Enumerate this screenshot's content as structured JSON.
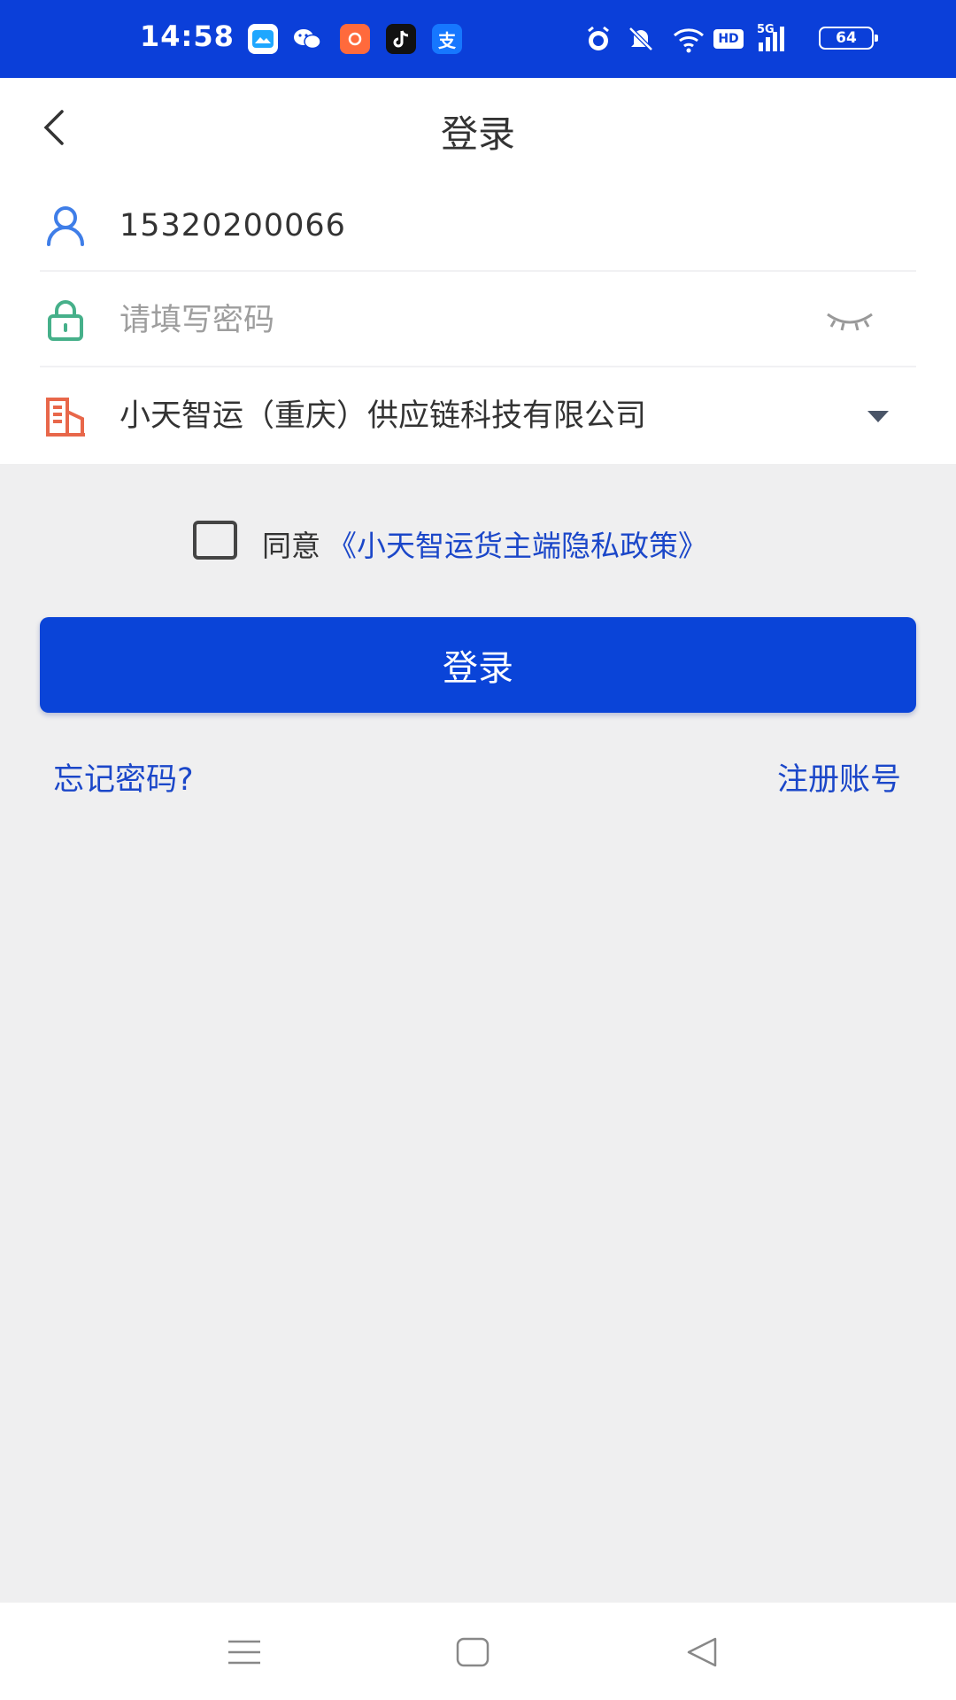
{
  "status_bar": {
    "time": "14:58",
    "apps": [
      "gallery-icon",
      "wechat-icon",
      "app-icon",
      "tiktok-icon",
      "alipay-icon"
    ],
    "alipay_glyph": "支",
    "signal_label": "5G",
    "hd_label": "HD",
    "battery": "64"
  },
  "header": {
    "title": "登录",
    "back_icon": "chevron-left-icon"
  },
  "form": {
    "phone": "15320200066",
    "password_placeholder": "请填写密码",
    "company": "小天智运（重庆）供应链科技有限公司"
  },
  "agreement": {
    "label": "同意",
    "link": "《小天智运货主端隐私政策》",
    "checked": false
  },
  "login_button": "登录",
  "links": {
    "forgot": "忘记密码?",
    "register": "注册账号"
  },
  "colors": {
    "primary": "#0a44d8",
    "link": "#1b47c9",
    "status_bar": "#0b3fd9",
    "user_icon": "#3f7ee8",
    "lock_icon": "#46b08a",
    "company_icon": "#e8674a"
  }
}
